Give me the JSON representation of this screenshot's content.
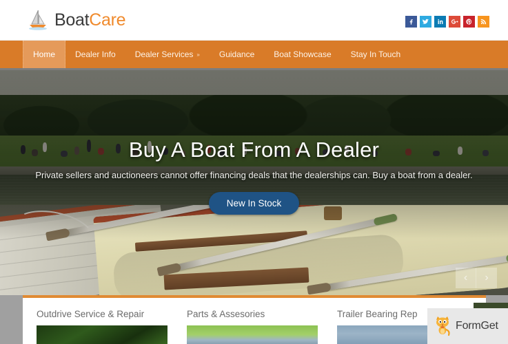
{
  "site": {
    "logo_text_primary": "Boat",
    "logo_text_accent": "Care",
    "logo_icon": "sailboat-icon",
    "accent_color": "#f08a2c",
    "nav_bg_color": "#d97b28",
    "cta_color": "#1f5385"
  },
  "social": {
    "items": [
      {
        "name": "facebook",
        "icon": "facebook-icon",
        "glyph": "f",
        "color": "#3b5998"
      },
      {
        "name": "twitter",
        "icon": "twitter-icon",
        "glyph": "t",
        "color": "#2eaae1"
      },
      {
        "name": "linkedin",
        "icon": "linkedin-icon",
        "glyph": "in",
        "color": "#0c7bb3"
      },
      {
        "name": "googleplus",
        "icon": "google-plus-icon",
        "glyph": "g+",
        "color": "#dd4b39"
      },
      {
        "name": "pinterest",
        "icon": "pinterest-icon",
        "glyph": "P",
        "color": "#c8232c"
      },
      {
        "name": "rss",
        "icon": "rss-icon",
        "glyph": "rss",
        "color": "#f7941e"
      }
    ]
  },
  "nav": {
    "items": [
      {
        "label": "Home",
        "active": true,
        "has_dropdown": false
      },
      {
        "label": "Dealer Info",
        "active": false,
        "has_dropdown": false
      },
      {
        "label": "Dealer Services",
        "active": false,
        "has_dropdown": true
      },
      {
        "label": "Guidance",
        "active": false,
        "has_dropdown": false
      },
      {
        "label": "Boat Showcase",
        "active": false,
        "has_dropdown": false
      },
      {
        "label": "Stay In Touch",
        "active": false,
        "has_dropdown": false
      }
    ],
    "dropdown_caret": "»"
  },
  "hero": {
    "title": "Buy A Boat From A Dealer",
    "subtitle": "Private sellers and auctioneers cannot offer financing deals that the dealerships can. Buy a boat from a dealer.",
    "cta_label": "New In Stock",
    "prev_arrow": "‹",
    "next_arrow": "›",
    "image_description": "Wooden rowboats with oars moored beside a park lake"
  },
  "services": {
    "columns": [
      {
        "title": "Outdrive Service & Repair",
        "thumb": "thumb-1"
      },
      {
        "title": "Parts & Assesories",
        "thumb": "thumb-2"
      },
      {
        "title": "Trailer Bearing Rep",
        "thumb": "thumb-3"
      }
    ]
  },
  "watermark": {
    "label": "FormGet",
    "icon": "cat-mascot-icon"
  }
}
